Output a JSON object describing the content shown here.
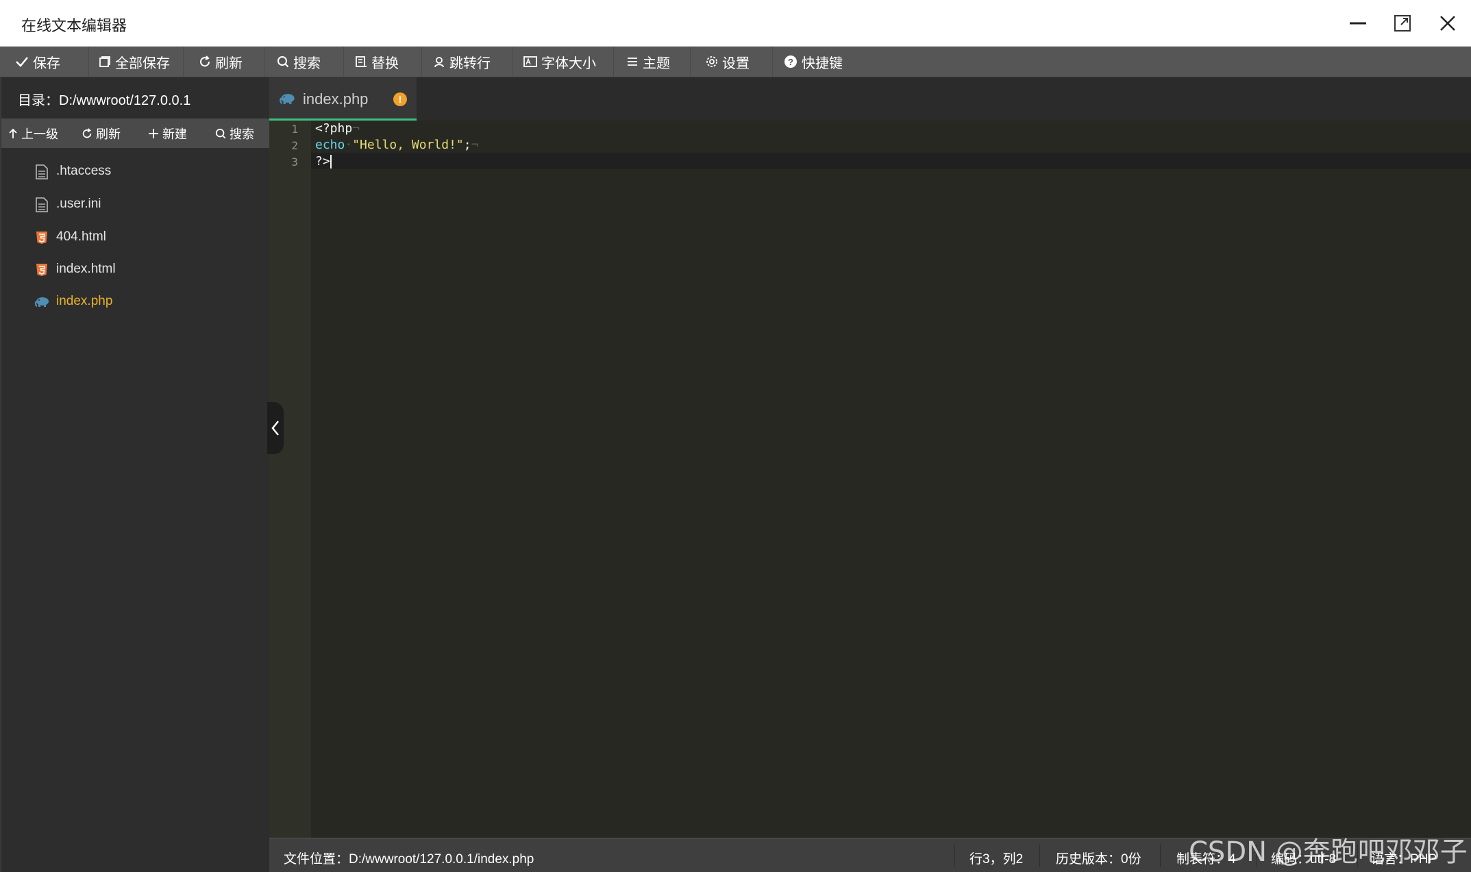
{
  "window": {
    "title": "在线文本编辑器"
  },
  "toolbar": {
    "items": [
      {
        "label": "保存",
        "icon": "check-icon"
      },
      {
        "label": "全部保存",
        "icon": "copy-icon"
      },
      {
        "label": "刷新",
        "icon": "refresh-icon"
      },
      {
        "label": "搜索",
        "icon": "search-icon"
      },
      {
        "label": "替换",
        "icon": "replace-icon"
      },
      {
        "label": "跳转行",
        "icon": "goto-icon"
      },
      {
        "label": "字体大小",
        "icon": "font-size-icon"
      },
      {
        "label": "主题",
        "icon": "menu-icon"
      },
      {
        "label": "设置",
        "icon": "gear-icon"
      },
      {
        "label": "快捷键",
        "icon": "help-icon"
      }
    ]
  },
  "sidebar": {
    "directory": "目录：D:/wwwroot/127.0.0.1",
    "tools": [
      {
        "label": "上一级",
        "icon": "arrow-up-icon"
      },
      {
        "label": "刷新",
        "icon": "refresh-icon"
      },
      {
        "label": "新建",
        "icon": "plus-icon"
      },
      {
        "label": "搜索",
        "icon": "search-icon"
      }
    ],
    "files": [
      {
        "name": ".htaccess",
        "icon": "file-text-icon"
      },
      {
        "name": ".user.ini",
        "icon": "file-text-icon"
      },
      {
        "name": "404.html",
        "icon": "html5-icon"
      },
      {
        "name": "index.html",
        "icon": "html5-icon"
      },
      {
        "name": "index.php",
        "icon": "php-elephant-icon",
        "active": true
      }
    ]
  },
  "editor": {
    "tab": {
      "label": "index.php",
      "badge": "!"
    },
    "line_numbers": [
      "1",
      "2",
      "3"
    ],
    "code": {
      "line1": "<?php",
      "line2_kw": "echo",
      "line2_str": "\"Hello, World!\"",
      "line2_end": ";",
      "line3": "?>"
    },
    "whitespace_marker": "¬"
  },
  "statusbar": {
    "file_path": "文件位置：D:/wwwroot/127.0.0.1/index.php",
    "cursor_pos": "行3，列2",
    "history": "历史版本：0份",
    "tab_size": "制表符：4",
    "encoding": "编码：utf-8",
    "language": "语言：PHP"
  },
  "watermark": "CSDN @奔跑吧邓邓子",
  "colors": {
    "accent_green": "#3fbf7f",
    "active_file": "#e9b32a",
    "editor_bg": "#272822",
    "keyword": "#66d9ef",
    "string": "#e6db74",
    "warning": "#f1a22b"
  }
}
